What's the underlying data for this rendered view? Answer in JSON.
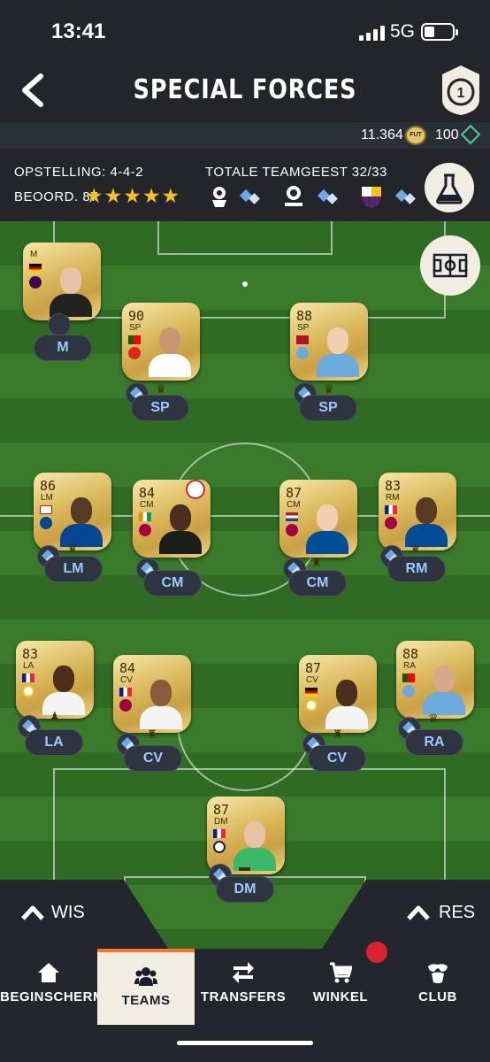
{
  "status": {
    "time": "13:41",
    "network": "5G"
  },
  "header": {
    "title": "SPECIAL FORCES",
    "chem_badge_value": "1"
  },
  "currency": {
    "coins": "11.364",
    "coin_label": "FUT",
    "points": "100"
  },
  "team": {
    "formation": "OPSTELLING: 4-4-2",
    "rating": "BEOORD. 87",
    "stars": "★★★★★",
    "chemistry": "TOTALE TEAMGEEST 32/33"
  },
  "colors": {
    "accent": "#ff6f2e",
    "gold": "#d9b75a",
    "pitch": "#3a7a2b",
    "chem_blue": "#6aa8e8"
  },
  "players": [
    {
      "id": "manager",
      "rating": "",
      "pos": "M",
      "tag": "M"
    },
    {
      "id": "sp-left",
      "rating": "90",
      "pos": "SP",
      "tag": "SP"
    },
    {
      "id": "sp-right",
      "rating": "88",
      "pos": "SP",
      "tag": "SP"
    },
    {
      "id": "lm",
      "rating": "86",
      "pos": "LM",
      "tag": "LM"
    },
    {
      "id": "cm-left",
      "rating": "84",
      "pos": "CM",
      "tag": "CM"
    },
    {
      "id": "cm-right",
      "rating": "87",
      "pos": "CM",
      "tag": "CM"
    },
    {
      "id": "rm",
      "rating": "83",
      "pos": "RM",
      "tag": "RM"
    },
    {
      "id": "la",
      "rating": "83",
      "pos": "LA",
      "tag": "LA"
    },
    {
      "id": "cv-left",
      "rating": "84",
      "pos": "CV",
      "tag": "CV"
    },
    {
      "id": "cv-right",
      "rating": "87",
      "pos": "CV",
      "tag": "CV"
    },
    {
      "id": "ra",
      "rating": "88",
      "pos": "RA",
      "tag": "RA"
    },
    {
      "id": "dm",
      "rating": "87",
      "pos": "DM",
      "tag": "DM"
    }
  ],
  "subs": {
    "left": "WIS",
    "right": "RES"
  },
  "nav": [
    {
      "label": "BEGINSCHERM",
      "icon": "home-icon"
    },
    {
      "label": "TEAMS",
      "icon": "teams-icon"
    },
    {
      "label": "TRANSFERS",
      "icon": "transfers-icon"
    },
    {
      "label": "WINKEL",
      "icon": "cart-icon"
    },
    {
      "label": "CLUB",
      "icon": "club-icon"
    }
  ]
}
